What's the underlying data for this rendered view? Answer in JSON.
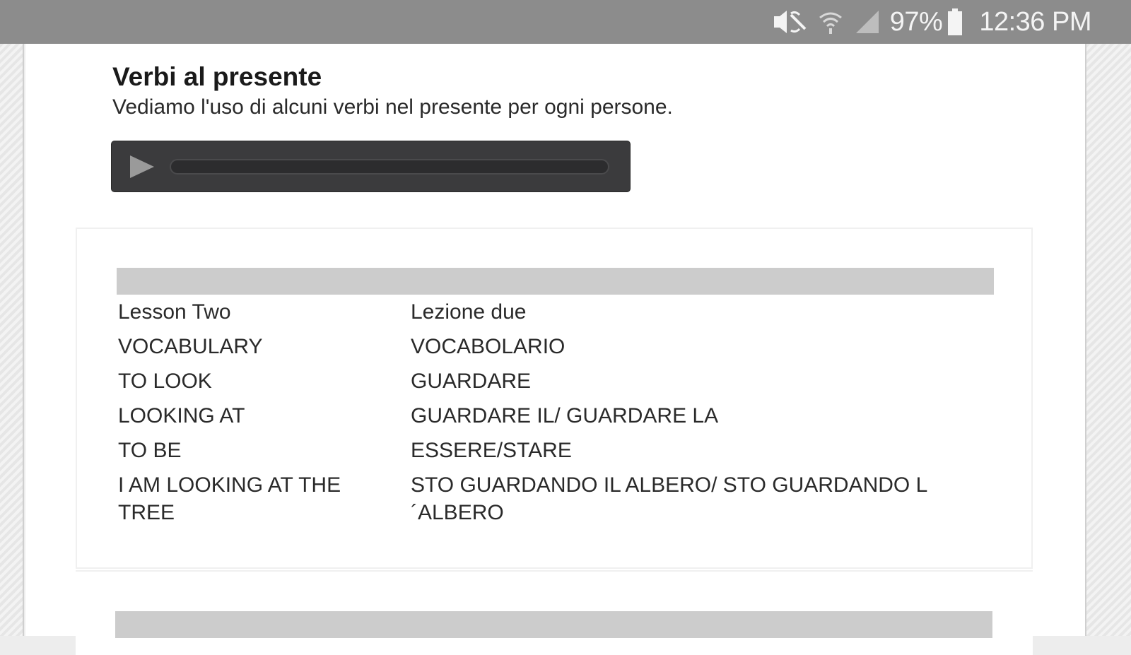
{
  "status_bar": {
    "battery": "97%",
    "time": "12:36 PM",
    "icons": [
      "mute-icon",
      "wifi-icon",
      "signal-icon",
      "battery-icon"
    ]
  },
  "lesson": {
    "title": "Verbi al presente",
    "subtitle": "Vediamo l'uso di alcuni verbi nel presente per ogni persone."
  },
  "audio_player": {
    "progress": 0,
    "icon": "play-icon"
  },
  "vocab_table": {
    "rows": [
      {
        "en": "Lesson Two",
        "it": "Lezione due"
      },
      {
        "en": "VOCABULARY",
        "it": "VOCABOLARIO"
      },
      {
        "en": "TO LOOK",
        "it": "GUARDARE"
      },
      {
        "en": "LOOKING AT",
        "it": "GUARDARE IL/ GUARDARE LA"
      },
      {
        "en": "TO BE",
        "it": "ESSERE/STARE"
      },
      {
        "en": "I AM LOOKING AT THE TREE",
        "it": "STO GUARDANDO IL ALBERO/ STO GUARDANDO L ´ALBERO"
      }
    ]
  },
  "colors": {
    "status_bar": "#8c8c8c",
    "player_bg": "#3b3b3d",
    "table_header": "#cccccc"
  }
}
